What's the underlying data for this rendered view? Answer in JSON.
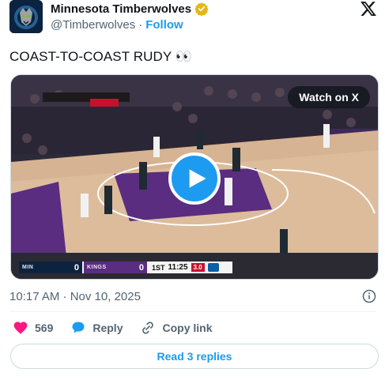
{
  "author": {
    "display_name": "Minnesota Timberwolves",
    "handle": "@Timberwolves",
    "separator": "·",
    "follow_label": "Follow",
    "avatar_icon": "timberwolves-logo-icon",
    "verified_icon": "verified-gold-badge-icon"
  },
  "tweet": {
    "text": "COAST-TO-COAST RUDY 👀",
    "timestamp": "10:17 AM · Nov 10, 2025"
  },
  "media": {
    "watch_label": "Watch on X",
    "play_icon": "play-icon",
    "scoreboard": {
      "home_abbr": "MIN",
      "home_score": "0",
      "away_abbr": "KINGS",
      "away_score": "0",
      "period": "1ST",
      "clock": "11:25",
      "shot_clock": "3.0"
    }
  },
  "actions": {
    "like_count": "569",
    "reply_label": "Reply",
    "copy_link_label": "Copy link"
  },
  "replies_button": "Read 3 replies",
  "colors": {
    "accent": "#1d9bf0",
    "like": "#f91880",
    "secondary_text": "#536471",
    "border": "#cfd9de"
  }
}
